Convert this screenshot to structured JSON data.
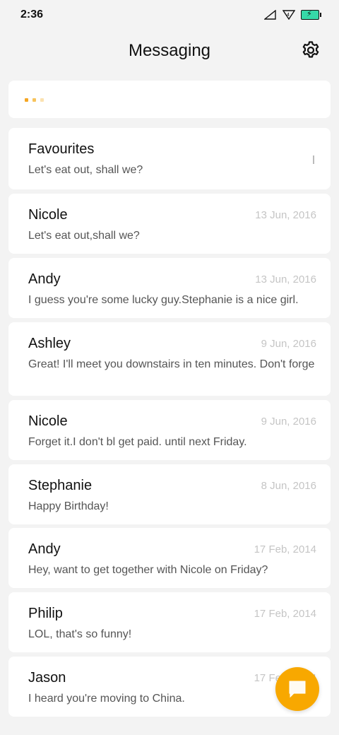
{
  "status": {
    "time": "2:36",
    "sim_badge": "4"
  },
  "header": {
    "title": "Messaging",
    "settings_icon": "gear-icon"
  },
  "loading": {
    "colors": [
      "#f5a623",
      "#f7c35c",
      "#fbe2b0"
    ]
  },
  "conversations": [
    {
      "name": "Favourites",
      "date": "",
      "preview": "Let's eat out, shall we?"
    },
    {
      "name": "Nicole",
      "date": "13 Jun, 2016",
      "preview": "Let's eat out,shall we?"
    },
    {
      "name": "Andy",
      "date": "13 Jun, 2016",
      "preview": "I guess you're some lucky guy.Stephanie is a nice girl."
    },
    {
      "name": "Ashley",
      "date": "9 Jun, 2016",
      "preview": "Great! I'll meet you downstairs in ten minutes. Don't forge"
    },
    {
      "name": "Nicole",
      "date": "9 Jun, 2016",
      "preview": "Forget it.I don't bl get paid. until next Friday."
    },
    {
      "name": "Stephanie",
      "date": "8 Jun, 2016",
      "preview": "Happy Birthday!"
    },
    {
      "name": "Andy",
      "date": "17 Feb, 2014",
      "preview": "Hey, want to get together with Nicole on Friday?"
    },
    {
      "name": "Philip",
      "date": "17 Feb, 2014",
      "preview": "LOL, that's so funny!"
    },
    {
      "name": "Jason",
      "date": "17 Feb, 2014",
      "preview": "I heard you're moving to China."
    }
  ],
  "fab": {
    "icon": "compose-message-icon",
    "color": "#f8a800"
  }
}
